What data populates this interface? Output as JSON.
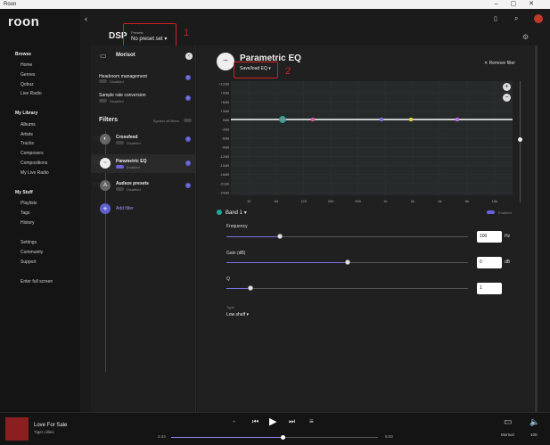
{
  "window": {
    "title": "Roon"
  },
  "sidebar": {
    "logo": "roon",
    "browse_title": "Browse",
    "browse_items": [
      "Home",
      "Genres",
      "Qobuz",
      "Live Radio"
    ],
    "library_title": "My Library",
    "library_items": [
      "Albums",
      "Artists",
      "Tracks",
      "Composers",
      "Compositions",
      "My Live Radio"
    ],
    "stuff_title": "My Stuff",
    "stuff_items": [
      "Playlists",
      "Tags",
      "History"
    ],
    "settings_items": [
      "Settings",
      "Community",
      "Support"
    ],
    "fullscreen": "Enter full screen"
  },
  "header": {
    "title": "DSP",
    "presets_label": "Presets",
    "presets_value": "No preset set"
  },
  "annotations": {
    "one": "1",
    "two": "2"
  },
  "left": {
    "zone": "Morisot",
    "headroom": {
      "label": "Headroom management",
      "status": "Disabled"
    },
    "src": {
      "label": "Sample rate conversion",
      "status": "Disabled"
    },
    "filters_title": "Filters",
    "bypass_label": "Bypass all filters",
    "filters": [
      {
        "name": "Crossfeed",
        "status": "Disabled"
      },
      {
        "name": "Parametric EQ",
        "status": "Enabled"
      },
      {
        "name": "Audeze presets",
        "status": "Disabled"
      }
    ],
    "add_filter": "Add filter"
  },
  "eq": {
    "title": "Parametric EQ",
    "save_load": "Save/load EQ",
    "remove_filter": "Remove filter",
    "y_labels": [
      "+12dB",
      "+9dB",
      "+6dB",
      "+3dB",
      "0dB",
      "-3dB",
      "-6dB",
      "-9dB",
      "-12dB",
      "-15dB",
      "-18dB",
      "-21dB",
      "-24dB"
    ],
    "x_labels": [
      "32",
      "64",
      "125",
      "250",
      "500",
      "1k",
      "2k",
      "4k",
      "8k",
      "16k"
    ],
    "band_label": "Band 1",
    "enabled_label": "Enabled",
    "frequency_label": "Frequency",
    "frequency_value": "100",
    "frequency_unit": "Hz",
    "gain_label": "Gain (dB)",
    "gain_value": "0",
    "gain_unit": "dB",
    "q_label": "Q",
    "q_value": "1",
    "type_label": "Type",
    "type_value": "Low shelf",
    "band_colors": [
      "#1fa89a",
      "#d95fa3",
      "#7a73e0",
      "#e0d040",
      "#c070e0"
    ],
    "slider_levels": {
      "frequency": 0.22,
      "gain": 0.5,
      "q": 0.1
    }
  },
  "player": {
    "track": "Love For Sale",
    "artist": "Tiger Lillies",
    "elapsed": "2:43",
    "total": "5:03",
    "progress": 0.54,
    "zone": "Morisot",
    "volume": "100"
  }
}
